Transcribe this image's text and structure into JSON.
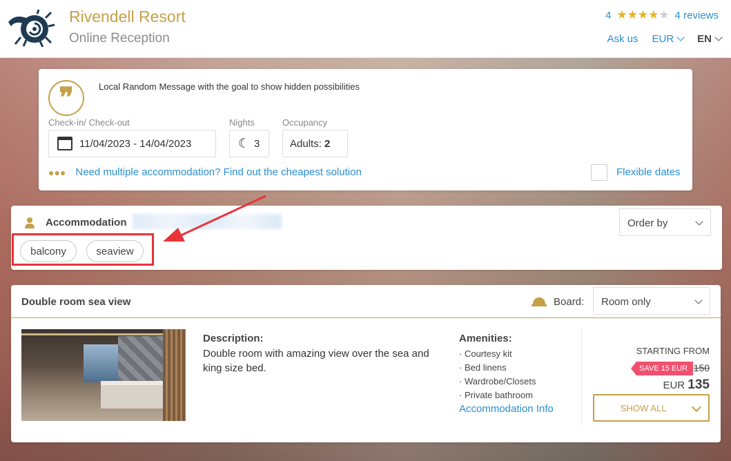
{
  "header": {
    "title": "Rivendell Resort",
    "subtitle": "Online Reception",
    "rating_value": "4",
    "stars": "★★★★",
    "stars_off": "★",
    "reviews_label": "4 reviews",
    "ask_us": "Ask us",
    "currency": "EUR",
    "language": "EN"
  },
  "search": {
    "message": "Local Random Message with the goal to show hidden possibilities",
    "checkin_label": "Check-in/ Check-out",
    "dates": "11/04/2023 - 14/04/2023",
    "nights_label": "Nights",
    "nights": "3",
    "occupancy_label": "Occupancy",
    "adults_label": "Adults: ",
    "adults": "2",
    "multi_link": "Need multiple accommodation? Find out the cheapest solution",
    "flexible_label": "Flexible dates"
  },
  "filter": {
    "title": "Accommodation",
    "order_by": "Order by",
    "tags": [
      "balcony",
      "seaview"
    ]
  },
  "room": {
    "title": "Double room sea view",
    "board_label": "Board:",
    "board_value": "Room only",
    "description_heading": "Description:",
    "description": "Double room with amazing view over the sea and king size bed.",
    "amenities_heading": "Amenities:",
    "amenities": [
      "Courtesy kit",
      "Bed linens",
      "Wardrobe/Closets",
      "Private bathroom"
    ],
    "accommodation_info": "Accommodation Info",
    "starting_from": "STARTING FROM",
    "save_badge": "SAVE 15 EUR",
    "old_price": "150",
    "currency": "EUR",
    "price": "135",
    "show_all": "SHOW ALL"
  },
  "colors": {
    "accent": "#c5a048",
    "link": "#2a8fcf",
    "highlight": "#e8333a",
    "badge": "#f0506e"
  }
}
